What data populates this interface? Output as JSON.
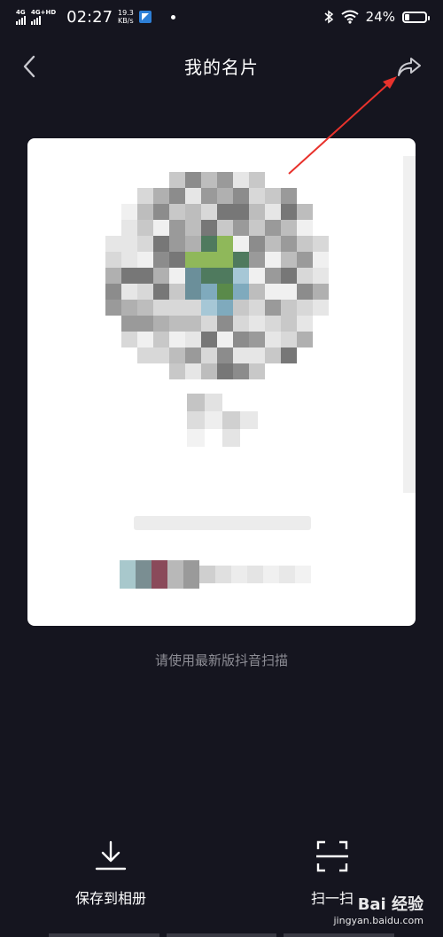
{
  "status_bar": {
    "signal1_label": "4G",
    "signal2_label": "4G+HD",
    "time": "02:27",
    "speed_value": "19.3",
    "speed_unit": "KB/s",
    "battery_percent": "24%",
    "battery_level": 0.24
  },
  "nav": {
    "title": "我的名片",
    "back_icon": "chevron-left-icon",
    "share_icon": "share-arrow-icon"
  },
  "card": {
    "blurred": true
  },
  "hint": "请使用最新版抖音扫描",
  "actions": {
    "save_label": "保存到相册",
    "save_icon": "download-icon",
    "scan_label": "扫一扫",
    "scan_icon": "scan-icon"
  },
  "watermark": {
    "logo": "Bai 经验",
    "site": "jingyan.baidu.com"
  },
  "colors": {
    "background": "#15151f",
    "card": "#ffffff",
    "hint_text": "#8e8e96",
    "annotation_arrow": "#e8322c"
  }
}
